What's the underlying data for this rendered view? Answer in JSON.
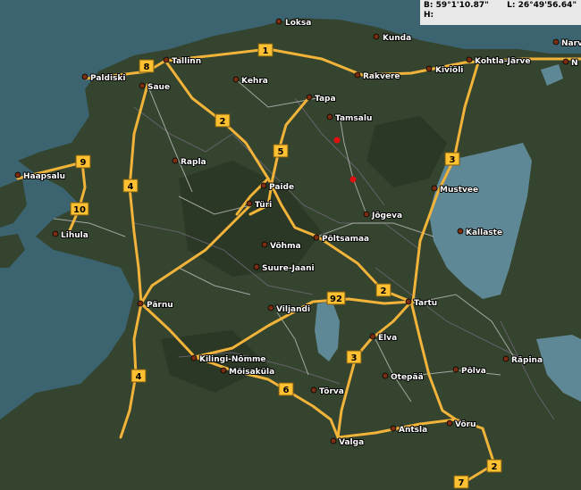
{
  "readout": {
    "lat_label": "B:",
    "lat_value": "59°1'10.87\"",
    "lon_label": "L:",
    "lon_value": "26°49'56.64\"",
    "h_label": "H:"
  },
  "colors": {
    "land": "#34442e",
    "land_dark": "#24301f",
    "sea": "#3b6470",
    "lake": "#5f8896",
    "road": "#f2b33a",
    "minor_road": "#c9c9c9",
    "shield": "#ffc132",
    "marker": "#e01010"
  },
  "cities": [
    {
      "name": "Loksa"
    },
    {
      "name": "Kunda"
    },
    {
      "name": "Narv"
    },
    {
      "name": "N"
    },
    {
      "name": "Paldiski"
    },
    {
      "name": "Tallinn"
    },
    {
      "name": "Saue"
    },
    {
      "name": "Kehra"
    },
    {
      "name": "Rakvere"
    },
    {
      "name": "Kiviõli"
    },
    {
      "name": "Kohtla-Järve"
    },
    {
      "name": "Tapa"
    },
    {
      "name": "Tamsalu"
    },
    {
      "name": "Rapla"
    },
    {
      "name": "Haapsalu"
    },
    {
      "name": "Paide"
    },
    {
      "name": "Mustvee"
    },
    {
      "name": "Türi"
    },
    {
      "name": "Jõgeva"
    },
    {
      "name": "Kallaste"
    },
    {
      "name": "Lihula"
    },
    {
      "name": "Võhma"
    },
    {
      "name": "Põltsamaa"
    },
    {
      "name": "Suure-Jaani"
    },
    {
      "name": "Pärnu"
    },
    {
      "name": "Viljandi"
    },
    {
      "name": "Tartu"
    },
    {
      "name": "Elva"
    },
    {
      "name": "Räpina"
    },
    {
      "name": "Kilingi-Nõmme"
    },
    {
      "name": "Mõisaküla"
    },
    {
      "name": "Otepää"
    },
    {
      "name": "Põlva"
    },
    {
      "name": "Tõrva"
    },
    {
      "name": "Antsla"
    },
    {
      "name": "Võru"
    },
    {
      "name": "Valga"
    }
  ],
  "roads": [
    {
      "number": "1"
    },
    {
      "number": "8"
    },
    {
      "number": "2"
    },
    {
      "number": "5"
    },
    {
      "number": "3"
    },
    {
      "number": "9"
    },
    {
      "number": "4"
    },
    {
      "number": "10"
    },
    {
      "number": "2"
    },
    {
      "number": "92"
    },
    {
      "number": "3"
    },
    {
      "number": "4"
    },
    {
      "number": "6"
    },
    {
      "number": "2"
    },
    {
      "number": "7"
    }
  ],
  "markers": [
    {
      "name": "point-a"
    },
    {
      "name": "point-b"
    }
  ]
}
